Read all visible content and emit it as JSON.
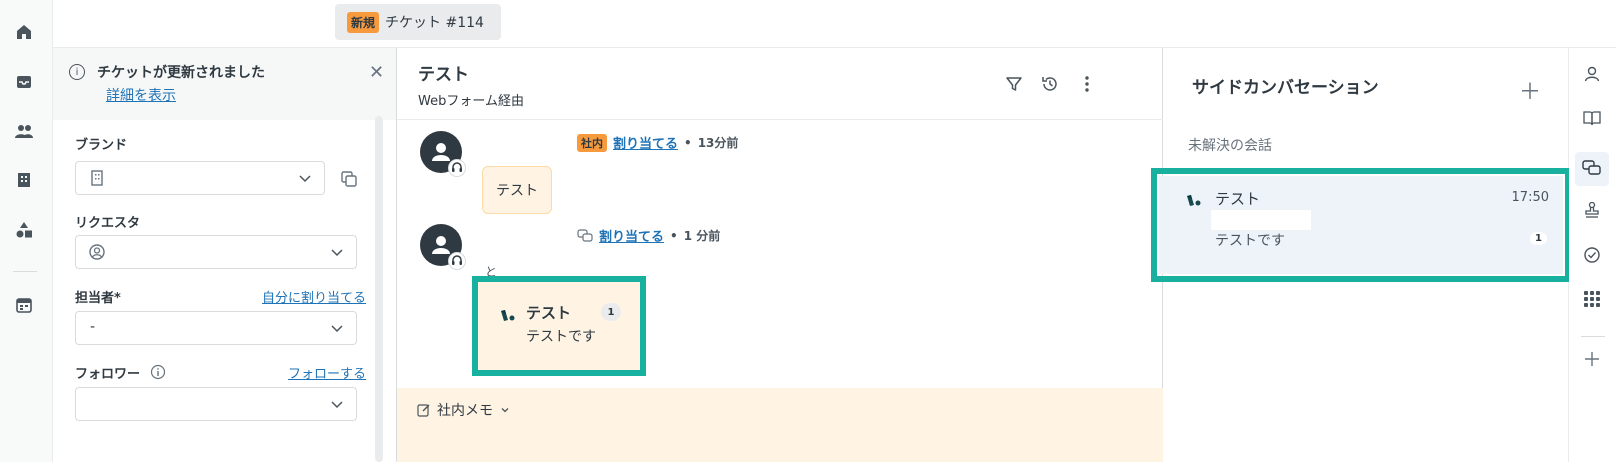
{
  "header": {
    "status_badge": "新規",
    "ticket_tab_title": "チケット #114"
  },
  "notice": {
    "title": "チケットが更新されました",
    "link": "詳細を表示"
  },
  "fields": {
    "brand_label": "ブランド",
    "requester_label": "リクエスタ",
    "assignee_label": "担当者*",
    "assign_self_link": "自分に割り当てる",
    "assignee_value": "-",
    "followers_label": "フォロワー",
    "follow_link": "フォローする"
  },
  "conversation": {
    "title": "テスト",
    "via": "Webフォーム経由",
    "messages": [
      {
        "tag": "社内",
        "assign_link": "割り当てる",
        "time": "13分前",
        "body": "テスト"
      },
      {
        "assign_link": "割り当てる",
        "time": "1 分前",
        "to_label": "と",
        "side_conversation_title": "テスト",
        "side_conversation_count": "1",
        "side_conversation_body": "テストです"
      }
    ],
    "composer_mode": "社内メモ"
  },
  "side_panel": {
    "title": "サイドカンバセーション",
    "section": "未解決の会話",
    "items": [
      {
        "title": "テスト",
        "time": "17:50",
        "body": "テストです",
        "count": "1"
      }
    ]
  },
  "colors": {
    "highlight": "#18b1a0",
    "accent_orange": "#f79a3e",
    "link_blue": "#1f73b7"
  },
  "icons": {
    "left_rail": [
      "home-icon",
      "inbox-icon",
      "users-icon",
      "building-icon",
      "shapes-icon",
      "calendar-icon"
    ],
    "right_rail": [
      "user-icon",
      "book-icon",
      "chat-icon",
      "stamp-icon",
      "check-circle-icon",
      "apps-grid-icon",
      "plus-icon"
    ]
  }
}
